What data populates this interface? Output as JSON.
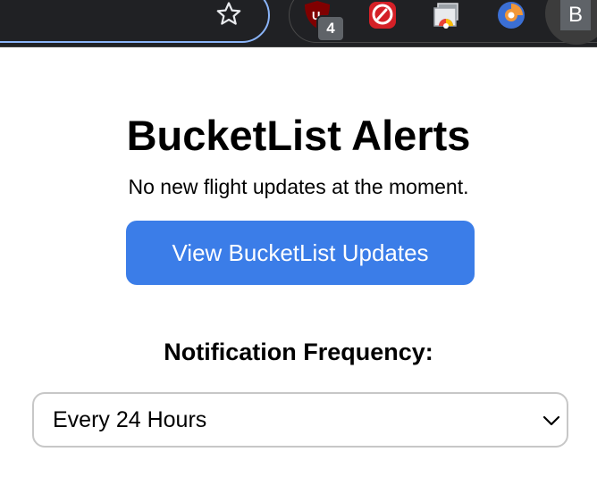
{
  "browser": {
    "extensions": [
      {
        "name": "ublock-origin",
        "icon": "shield-icon",
        "color": "#800000",
        "badge_count": "4"
      },
      {
        "name": "red-extension",
        "icon": "red-circle-icon",
        "color": "#d42027"
      },
      {
        "name": "chrome-cast",
        "icon": "chrome-window-icon",
        "color": "#4285f4"
      },
      {
        "name": "orange-extension",
        "icon": "blue-circle-icon",
        "color": "#f29738"
      }
    ],
    "profile_initial": "B"
  },
  "popup": {
    "title": "BucketList Alerts",
    "status": "No new flight updates at the moment.",
    "view_updates_label": "View BucketList Updates",
    "frequency_label": "Notification Frequency:",
    "frequency_selected": "Every 24 Hours",
    "accent_color": "#3b7de8"
  }
}
